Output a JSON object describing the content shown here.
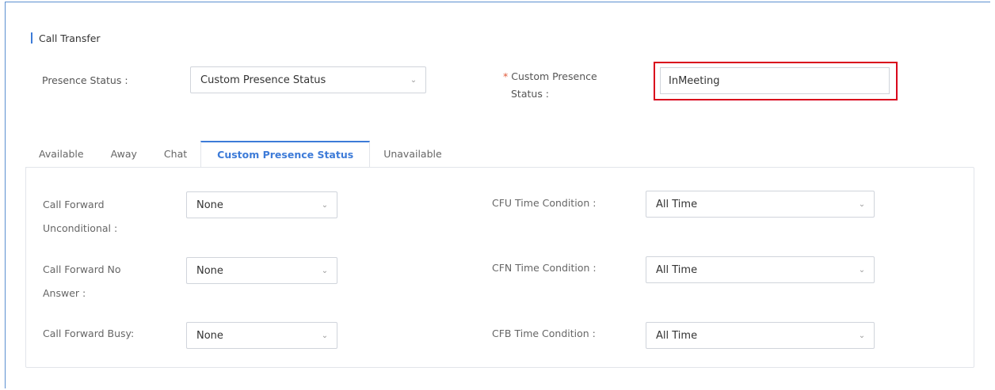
{
  "section": {
    "title": "Call Transfer"
  },
  "presence": {
    "label": "Presence Status :",
    "selected": "Custom Presence Status",
    "custom_required_mark": "*",
    "custom_label_line1": "Custom Presence",
    "custom_label_line2": "Status :",
    "custom_value": "InMeeting"
  },
  "tabs": [
    {
      "label": "Available",
      "active": false
    },
    {
      "label": "Away",
      "active": false
    },
    {
      "label": "Chat",
      "active": false
    },
    {
      "label": "Custom Presence Status",
      "active": true
    },
    {
      "label": "Unavailable",
      "active": false
    }
  ],
  "forward": {
    "cfu_label_line1": "Call Forward",
    "cfu_label_line2": "Unconditional :",
    "cfu_value": "None",
    "cfu_time_label": "CFU Time Condition :",
    "cfu_time_value": "All Time",
    "cfn_label_line1": "Call Forward No",
    "cfn_label_line2": "Answer :",
    "cfn_value": "None",
    "cfn_time_label": "CFN Time Condition :",
    "cfn_time_value": "All Time",
    "cfb_label": "Call Forward Busy:",
    "cfb_value": "None",
    "cfb_time_label": "CFB Time Condition :",
    "cfb_time_value": "All Time"
  },
  "icons": {
    "dropdown": "chevron-down-icon"
  },
  "colors": {
    "accent": "#3d7bd8",
    "highlight_box": "#d9001b",
    "required": "#e05a3a"
  }
}
